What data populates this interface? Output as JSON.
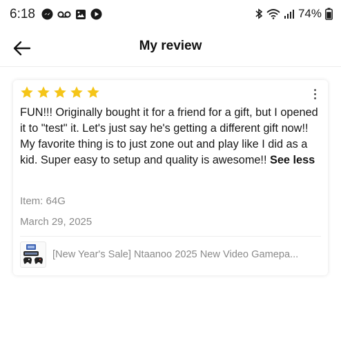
{
  "status_bar": {
    "time": "6:18",
    "battery": "74%",
    "icons": [
      "messenger-icon",
      "voicemail-icon",
      "gallery-icon",
      "media-icon",
      "bluetooth-icon",
      "wifi-icon",
      "signal-icon",
      "battery-icon"
    ]
  },
  "header": {
    "title": "My review",
    "back_icon": "arrow-left-icon"
  },
  "review": {
    "rating": 5,
    "max_rating": 5,
    "star_color": "#F5C518",
    "text": "FUN!!! Originally bought it for a friend for a gift, but I opened it to \"test\" it. Let's just say he's getting a different gift now!! My favorite thing is to just zone out and play like I did as a kid. Super easy to setup and quality is awesome!!",
    "see_less": "See less",
    "item": "Item: 64G",
    "date": "March 29, 2025",
    "more_icon": "more-vertical-icon"
  },
  "product": {
    "title": "[New Year's Sale] Ntaanoo 2025 New Video Gamepa..."
  }
}
